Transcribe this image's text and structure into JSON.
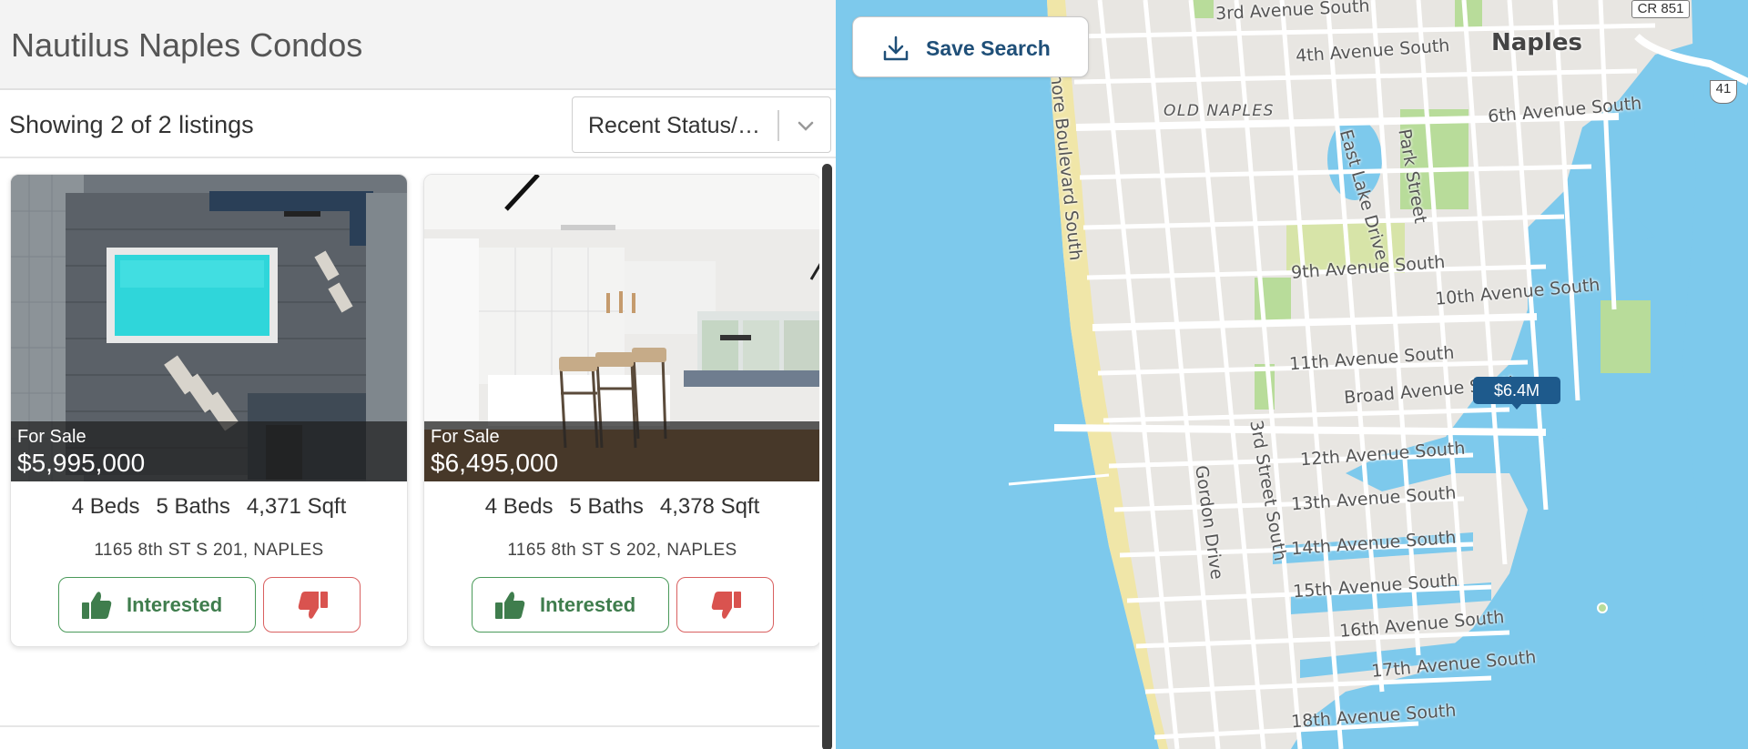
{
  "header": {
    "title": "Nautilus Naples Condos"
  },
  "listbar": {
    "count_text": "Showing 2 of 2 listings",
    "sort_value": "Recent Status/Price"
  },
  "listings": [
    {
      "status": "For Sale",
      "price": "$5,995,000",
      "beds": "4 Beds",
      "baths": "5 Baths",
      "sqft": "4,371 Sqft",
      "address": "1165 8th ST S 201, NAPLES",
      "interested_label": "Interested"
    },
    {
      "status": "For Sale",
      "price": "$6,495,000",
      "beds": "4 Beds",
      "baths": "5 Baths",
      "sqft": "4,378 Sqft",
      "address": "1165 8th ST S 202, NAPLES",
      "interested_label": "Interested"
    }
  ],
  "map": {
    "save_search_label": "Save Search",
    "price_pin": "$6.4M",
    "city_label": "Naples",
    "neighborhood_label": "OLD NAPLES",
    "route_shield_1": "CR 851",
    "route_shield_2": "41",
    "streets": {
      "ave3": "3rd Avenue South",
      "ave4": "4th Avenue South",
      "ave6": "6th Avenue South",
      "ave9": "9th Avenue South",
      "ave10": "10th Avenue South",
      "ave11": "11th Avenue South",
      "broad": "Broad Avenue South",
      "ave12": "12th Avenue South",
      "ave13": "13th Avenue South",
      "ave14": "14th Avenue South",
      "ave15": "15th Avenue South",
      "ave16": "16th Avenue South",
      "ave17": "17th Avenue South",
      "ave18": "18th Avenue South",
      "shore": "hore Boulevard South",
      "eastlake": "East Lake Drive",
      "park": "Park Street",
      "third": "3rd Street South",
      "gordon": "Gordon Drive"
    }
  },
  "colors": {
    "water": "#7dc9ec",
    "land": "#e8e6e2",
    "park": "#b8dc9a",
    "beach": "#f0e6a8",
    "interested_green": "#3f7d4d",
    "dislike_red": "#d9534f",
    "pin_blue": "#1e5a8c"
  },
  "icons": {
    "thumbs_up": "thumbs-up-icon",
    "thumbs_down": "thumbs-down-icon",
    "download": "download-icon",
    "chevron": "chevron-down-icon"
  }
}
